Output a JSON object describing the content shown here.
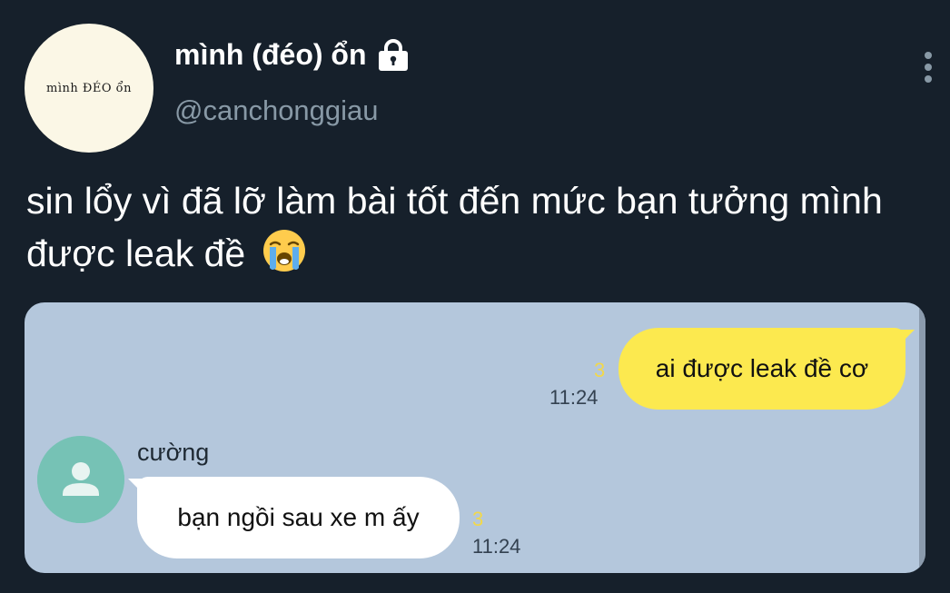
{
  "profile": {
    "avatar_text": "mình ĐÉO ổn",
    "display_name": "mình (đéo) ổn",
    "handle": "@canchonggiau"
  },
  "tweet": {
    "text": "sin lổy vì đã lỡ làm bài tốt đến mức bạn tưởng mình được leak đề"
  },
  "chat": {
    "outgoing": {
      "text": "ai được leak đề cơ",
      "count": "3",
      "time": "11:24"
    },
    "incoming": {
      "sender": "cường",
      "text": "bạn ngồi sau xe m ấy",
      "count": "3",
      "time": "11:24"
    }
  },
  "colors": {
    "background": "#16202b",
    "handle": "#8899a6",
    "media_background": "#b4c7dc",
    "outgoing_bubble": "#fce94f",
    "incoming_bubble": "#ffffff",
    "contact_avatar": "#76c2b5",
    "count": "#f2d84a"
  },
  "icons": {
    "lock": "lock-icon",
    "more": "more-options-icon",
    "emoji": "loudly-crying-face-emoji",
    "contact": "person-icon"
  }
}
